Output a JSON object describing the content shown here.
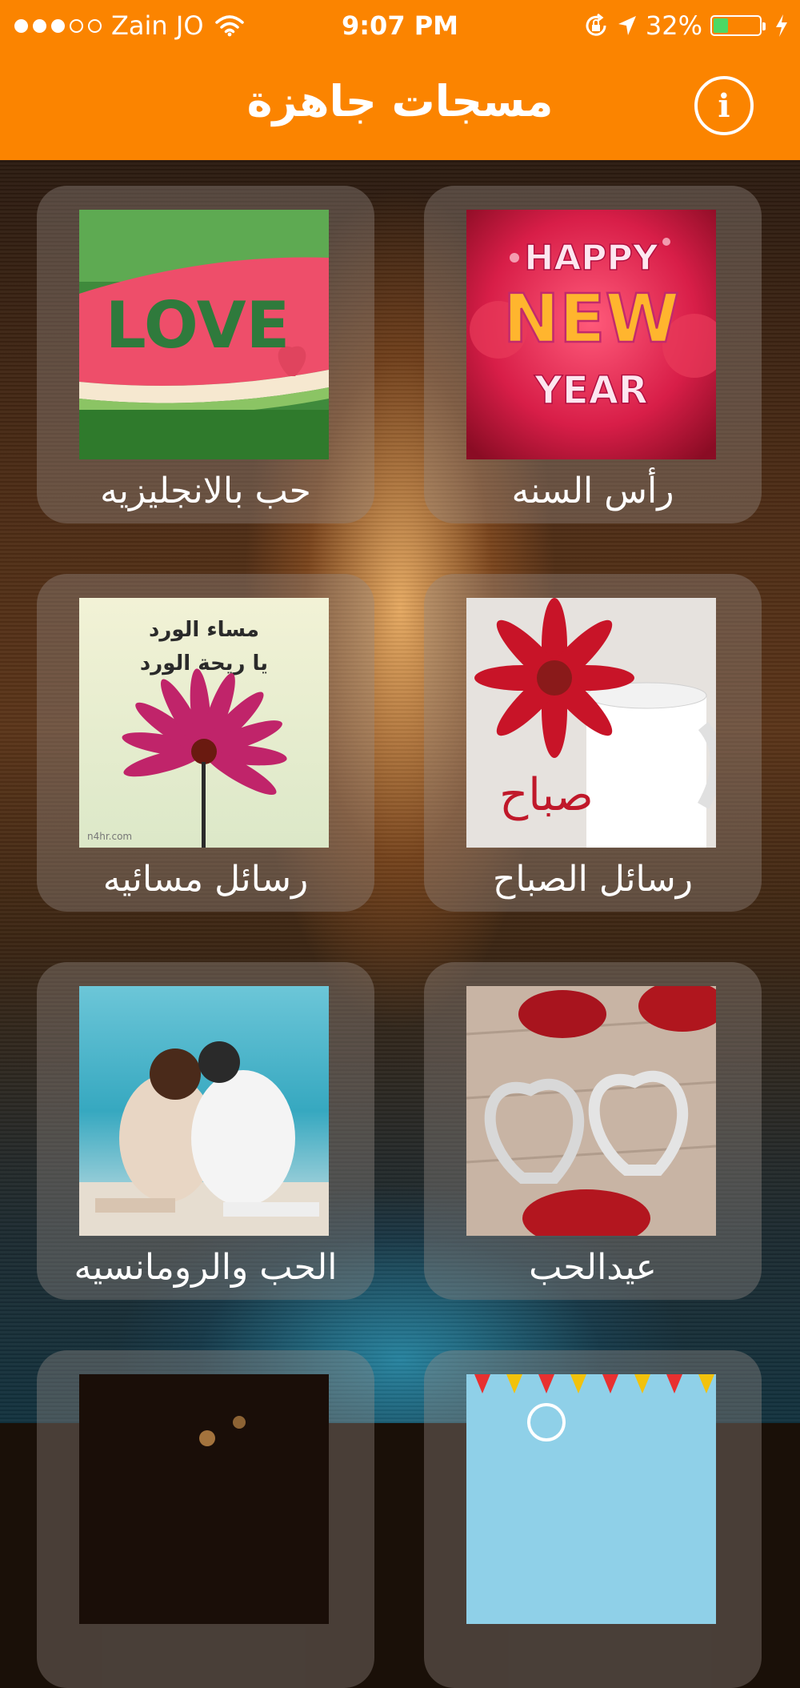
{
  "status_bar": {
    "carrier": "Zain JO",
    "time": "9:07 PM",
    "battery": "32%",
    "battery_level": 0.32
  },
  "header": {
    "title": "مسجات جاهزة",
    "info_icon": "info-icon",
    "info_glyph": "i",
    "background_color": "#fb8400"
  },
  "categories": [
    {
      "label": "رأس السنه",
      "image_text": [
        "HAPPY",
        "NEW",
        "YEAR"
      ]
    },
    {
      "label": "حب بالانجليزيه",
      "image_text": [
        "LOVE"
      ]
    },
    {
      "label": "رسائل الصباح",
      "image_text": [
        "صباح"
      ]
    },
    {
      "label": "رسائل مسائيه",
      "image_text": [
        "مساء الورد",
        "يا ريحة الورد",
        "n4hr.com"
      ]
    },
    {
      "label": "عيدالحب",
      "image_text": []
    },
    {
      "label": "الحب والرومانسيه",
      "image_text": []
    },
    {
      "label": "",
      "image_text": []
    },
    {
      "label": "",
      "image_text": []
    }
  ]
}
